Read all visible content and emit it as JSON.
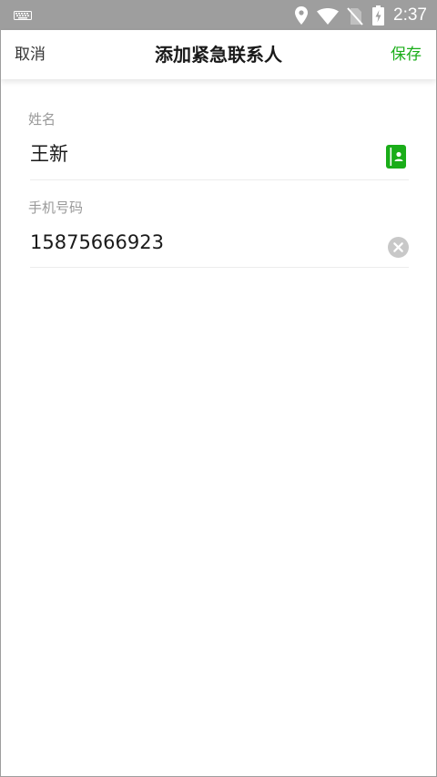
{
  "status_bar": {
    "time": "2:37",
    "icons": [
      "keyboard-icon",
      "location-icon",
      "wifi-icon",
      "no-sim-icon",
      "battery-charging-icon"
    ]
  },
  "header": {
    "cancel_label": "取消",
    "title": "添加紧急联系人",
    "save_label": "保存"
  },
  "form": {
    "name": {
      "label": "姓名",
      "value": "王新",
      "icon": "contact-book-icon"
    },
    "phone": {
      "label": "手机号码",
      "value": "15875666923",
      "icon": "clear-icon"
    }
  },
  "colors": {
    "accent": "#1aad19",
    "status_bar": "#9e9e9e",
    "label": "#999999",
    "text": "#1a1a1a"
  }
}
